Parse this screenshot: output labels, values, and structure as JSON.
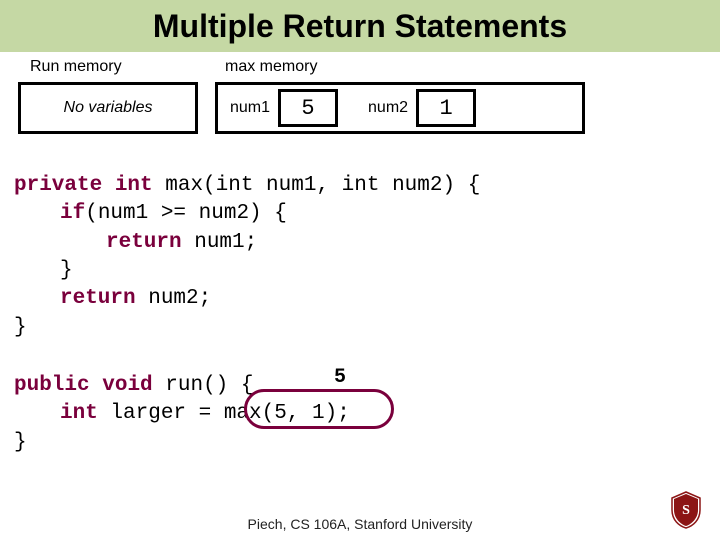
{
  "title": "Multiple Return Statements",
  "memory": {
    "run_label": "Run memory",
    "max_label": "max memory",
    "no_variables": "No variables",
    "num1": {
      "name": "num1",
      "value": "5"
    },
    "num2": {
      "name": "num2",
      "value": "1"
    }
  },
  "code": {
    "kw_private": "private",
    "kw_int": "int",
    "kw_if": "if",
    "kw_return": "return",
    "kw_public": "public",
    "kw_void": "void",
    "sig1_rest": " max(int num1, int num2) {",
    "if_cond": "(num1 >= num2) {",
    "ret1": " num1;",
    "closebrace": "}",
    "ret2": " num2;",
    "sig2_rest": " run() {",
    "decl_rest": " larger = max(5, 1);",
    "callout_value": "5"
  },
  "footer": "Piech, CS 106A, Stanford University"
}
